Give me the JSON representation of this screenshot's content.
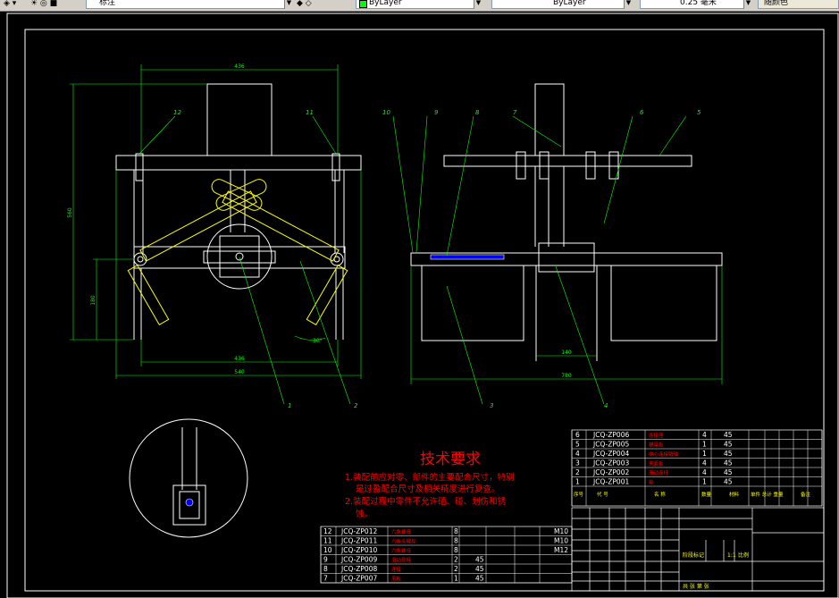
{
  "toolbar": {
    "layer_combo": "标注",
    "color_combo": "ByLayer",
    "linetype_combo": "ByLayer",
    "lineweight_combo": "0.25 毫米",
    "plotstyle_combo": "随颜色"
  },
  "drawing": {
    "tech_title": "技术要求",
    "tech_line1": "1.装配前应对零、部件的主要配合尺寸，特别",
    "tech_line2": "是过盈配合尺寸及相关精度进行复查。",
    "tech_line3": "2.装配过程中零件不允许磕、碰、划伤和锈",
    "tech_line4": "蚀。",
    "dims": {
      "top_width": "436",
      "overall_height": "560",
      "left_height": "180",
      "bottom_width": "436",
      "overall_width": "540",
      "angle": "30°",
      "side_width": "140",
      "side_total": "780"
    },
    "balloons": {
      "b12": "12",
      "b11": "11",
      "b10": "10",
      "b9": "9",
      "b8": "8",
      "b7": "7",
      "b6": "6",
      "b5": "5",
      "b1": "1",
      "b2": "2",
      "b3": "3",
      "b4": "4"
    }
  },
  "bom_upper": {
    "rows": [
      {
        "no": "6",
        "code": "JCQ-ZP006",
        "name": "连接座",
        "qty": "4",
        "mat": "45"
      },
      {
        "no": "5",
        "code": "JCQ-ZP005",
        "name": "横梁板",
        "qty": "1",
        "mat": "45"
      },
      {
        "no": "4",
        "code": "JCQ-ZP004",
        "name": "中心连接销轴",
        "qty": "1",
        "mat": "45"
      },
      {
        "no": "3",
        "code": "JCQ-ZP003",
        "name": "夹紧板",
        "qty": "4",
        "mat": "45"
      },
      {
        "no": "2",
        "code": "JCQ-ZP002",
        "name": "滑动连杆",
        "qty": "4",
        "mat": "45"
      },
      {
        "no": "1",
        "code": "JCQ-ZP001",
        "name": "轴",
        "qty": "1",
        "mat": "45"
      }
    ],
    "header_no": "序号",
    "header_code": "代 号",
    "header_name": "名 称",
    "header_qty": "数量",
    "header_mat": "材料",
    "header_weight": "单件 总计 重量",
    "header_note": "备注"
  },
  "bom_lower": {
    "rows": [
      {
        "no": "12",
        "code": "JCQ-ZP012",
        "name": "六角螺母",
        "qty": "8",
        "mat": "",
        "std": "M10"
      },
      {
        "no": "11",
        "code": "JCQ-ZP011",
        "name": "六角头螺栓",
        "qty": "8",
        "mat": "",
        "std": "M10"
      },
      {
        "no": "10",
        "code": "JCQ-ZP010",
        "name": "六角螺母",
        "qty": "8",
        "mat": "",
        "std": "M12"
      },
      {
        "no": "9",
        "code": "JCQ-ZP009",
        "name": "滑动导杆",
        "qty": "2",
        "mat": "45",
        "std": ""
      },
      {
        "no": "8",
        "code": "JCQ-ZP008",
        "name": "连接",
        "qty": "2",
        "mat": "45",
        "std": ""
      },
      {
        "no": "7",
        "code": "JCQ-ZP007",
        "name": "吊板",
        "qty": "1",
        "mat": "45",
        "std": ""
      }
    ]
  },
  "title_block": {
    "scale": "1:1",
    "mark": "阶段标记",
    "ratio": "比例",
    "count": "共 张 第 张"
  }
}
